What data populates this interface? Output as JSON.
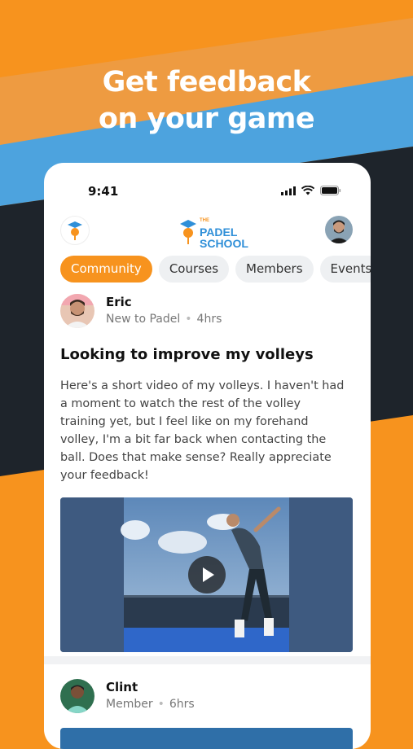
{
  "headline": {
    "line1": "Get feedback",
    "line2": "on your game"
  },
  "status_bar": {
    "time": "9:41"
  },
  "app": {
    "logo_the": "THE",
    "logo_padel": "PADEL",
    "logo_school": "SCHOOL"
  },
  "tabs": [
    {
      "label": "Community",
      "active": true
    },
    {
      "label": "Courses",
      "active": false
    },
    {
      "label": "Members",
      "active": false
    },
    {
      "label": "Events",
      "active": false
    }
  ],
  "posts": [
    {
      "author": "Eric",
      "role": "New to Padel",
      "time": "4hrs",
      "title": "Looking to improve my volleys",
      "body": "Here's a short video of my volleys. I haven't had a moment to watch the rest of the volley training yet, but I feel like on my forehand volley, I'm a bit far back when contacting the ball. Does that make sense? Really appreciate your feedback!"
    },
    {
      "author": "Clint",
      "role": "Member",
      "time": "6hrs"
    }
  ],
  "colors": {
    "orange": "#f7931e",
    "blue": "#4da3de",
    "dark": "#1e242b"
  },
  "icons": [
    "signal-icon",
    "wifi-icon",
    "battery-icon",
    "play-icon",
    "padel-school-logo-icon"
  ]
}
